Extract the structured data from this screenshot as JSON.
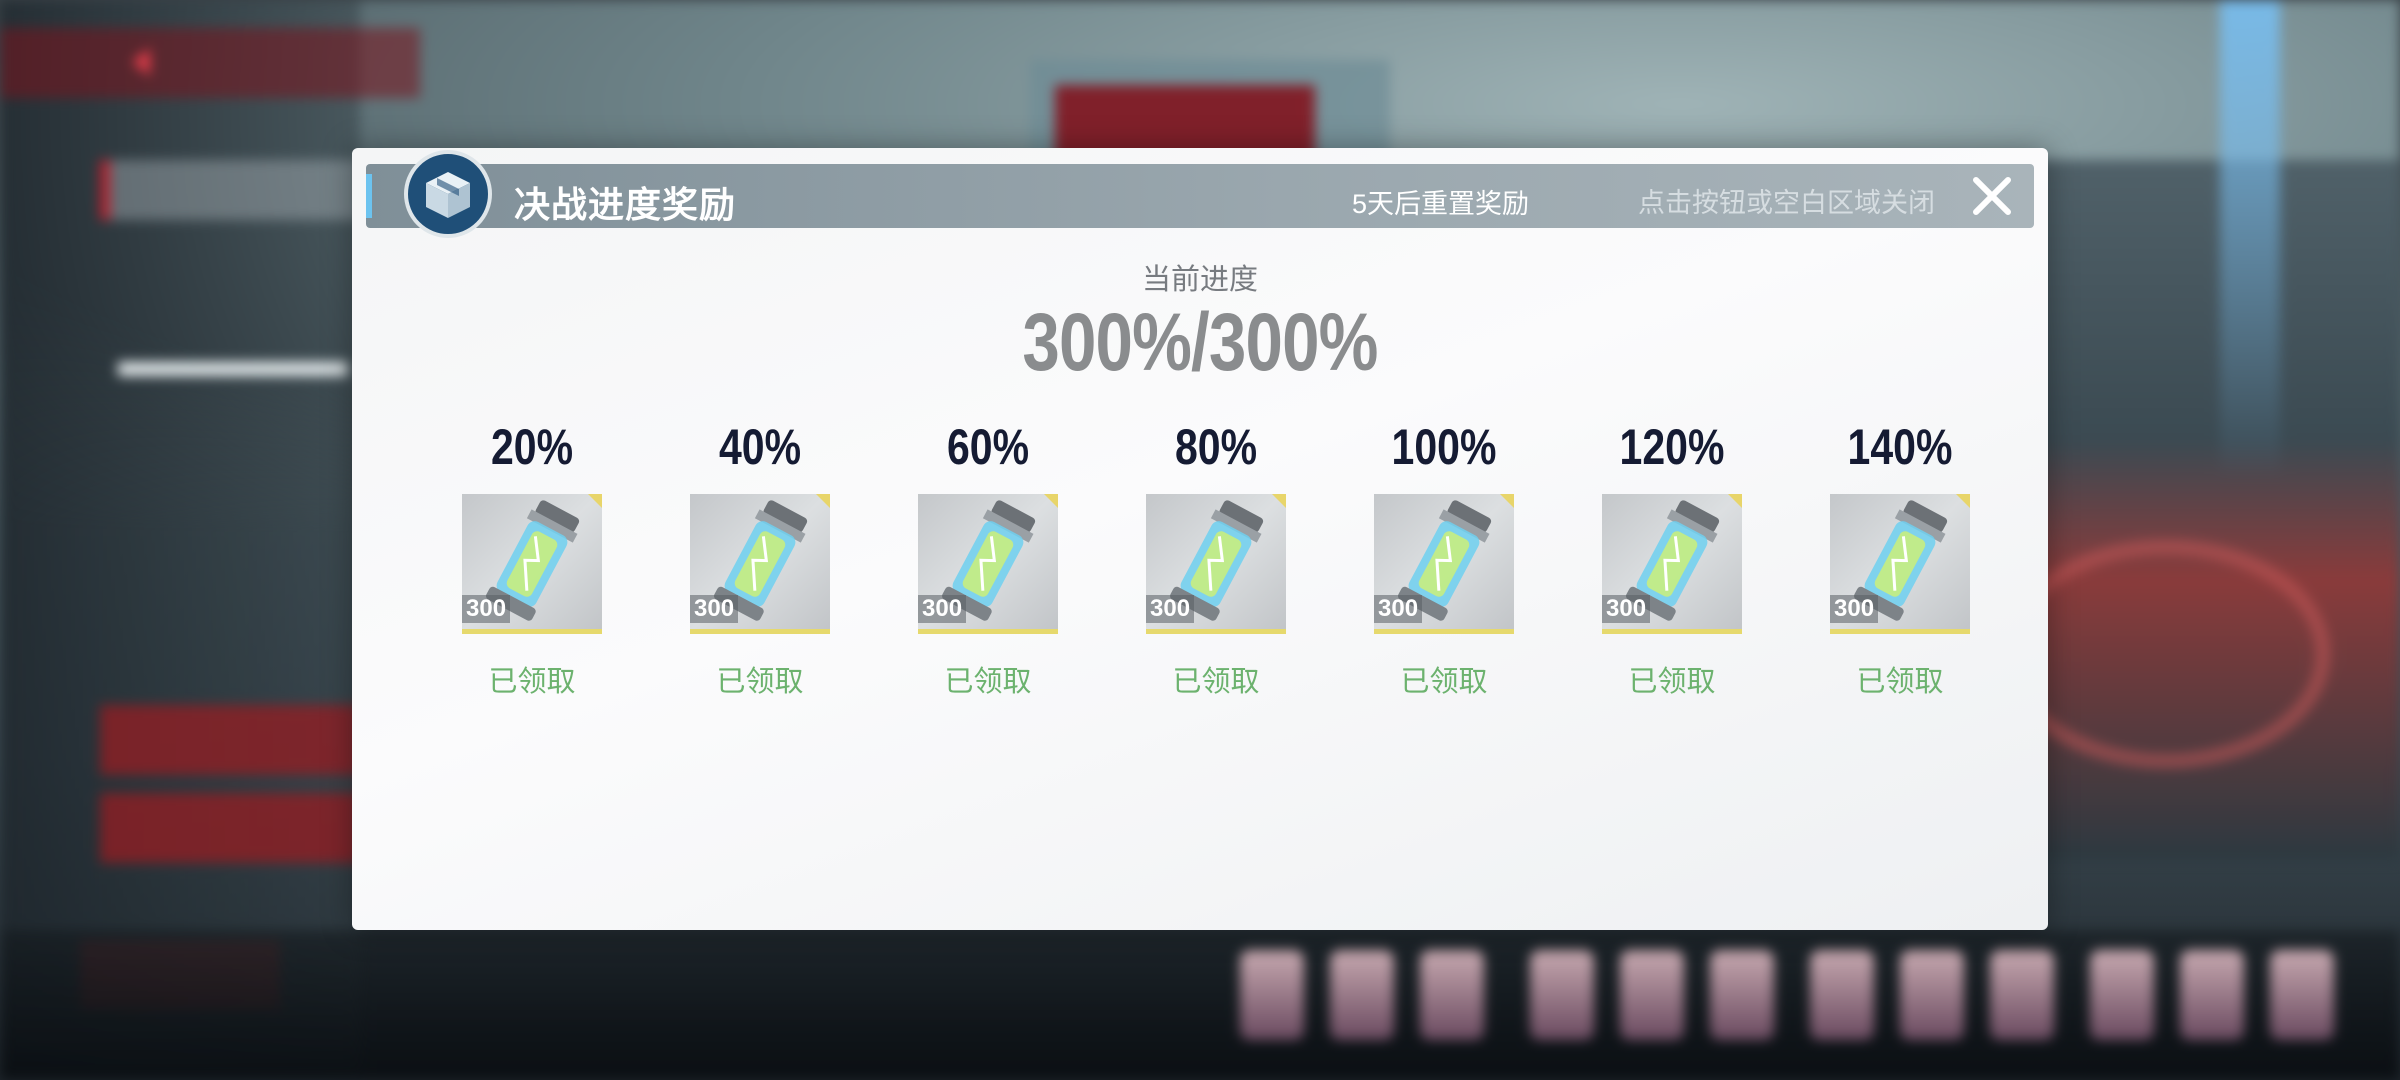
{
  "modal": {
    "title": "决战进度奖励",
    "reset_text": "5天后重置奖励",
    "close_hint": "点击按钮或空白区域关闭",
    "icon": "supply-box-icon"
  },
  "progress": {
    "label": "当前进度",
    "value": "300%/300%"
  },
  "rewards": [
    {
      "percent": "20%",
      "quantity": "300",
      "status": "已领取",
      "icon": "energy-canister-icon"
    },
    {
      "percent": "40%",
      "quantity": "300",
      "status": "已领取",
      "icon": "energy-canister-icon"
    },
    {
      "percent": "60%",
      "quantity": "300",
      "status": "已领取",
      "icon": "energy-canister-icon"
    },
    {
      "percent": "80%",
      "quantity": "300",
      "status": "已领取",
      "icon": "energy-canister-icon"
    },
    {
      "percent": "100%",
      "quantity": "300",
      "status": "已领取",
      "icon": "energy-canister-icon"
    },
    {
      "percent": "120%",
      "quantity": "300",
      "status": "已领取",
      "icon": "energy-canister-icon"
    },
    {
      "percent": "140%",
      "quantity": "300",
      "status": "已领取",
      "icon": "energy-canister-icon"
    }
  ],
  "colors": {
    "claimed_status": "#6cb26e",
    "header_bg": "#8e9ca4",
    "accent": "#6cc3ef",
    "icon_circle": "#1f4f78"
  }
}
